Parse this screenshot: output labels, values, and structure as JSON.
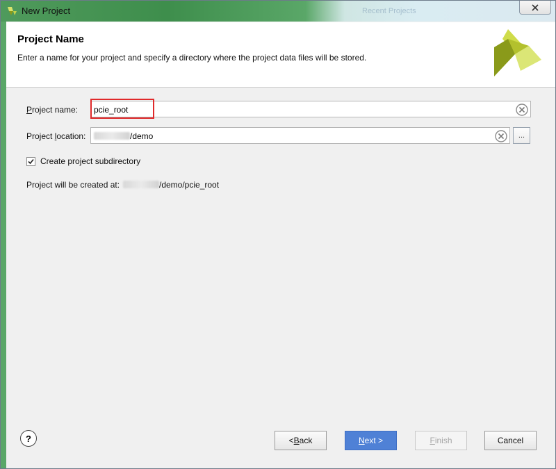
{
  "window": {
    "title": "New Project",
    "ghost_title": "Recent Projects"
  },
  "header": {
    "title": "Project Name",
    "description": "Enter a name for your project and specify a directory where the project data files will be stored."
  },
  "form": {
    "project_name": {
      "label_mnemonic": "P",
      "label_rest": "roject name:",
      "value": "pcie_root"
    },
    "project_location": {
      "label_prefix": "Project ",
      "label_mnemonic": "l",
      "label_rest": "ocation:",
      "value_suffix": "/demo",
      "browse_label": "..."
    },
    "create_subdirectory": {
      "label": "Create project subdirectory",
      "checked": true
    },
    "created_at": {
      "prefix": "Project will be created at: ",
      "suffix": "/demo/pcie_root"
    }
  },
  "footer": {
    "help_label": "?",
    "back": {
      "prefix": "< ",
      "mnemonic": "B",
      "rest": "ack"
    },
    "next": {
      "mnemonic": "N",
      "rest": "ext >"
    },
    "finish": {
      "mnemonic": "F",
      "rest": "inish"
    },
    "cancel": "Cancel"
  },
  "colors": {
    "accent": "#4f81d6",
    "highlight": "#e0292a",
    "logo_dark": "#8a9a1a",
    "logo_light": "#d7e36a"
  },
  "icons": [
    "app-logo-icon",
    "close-icon",
    "clear-icon",
    "checkmark-icon",
    "help-icon"
  ]
}
